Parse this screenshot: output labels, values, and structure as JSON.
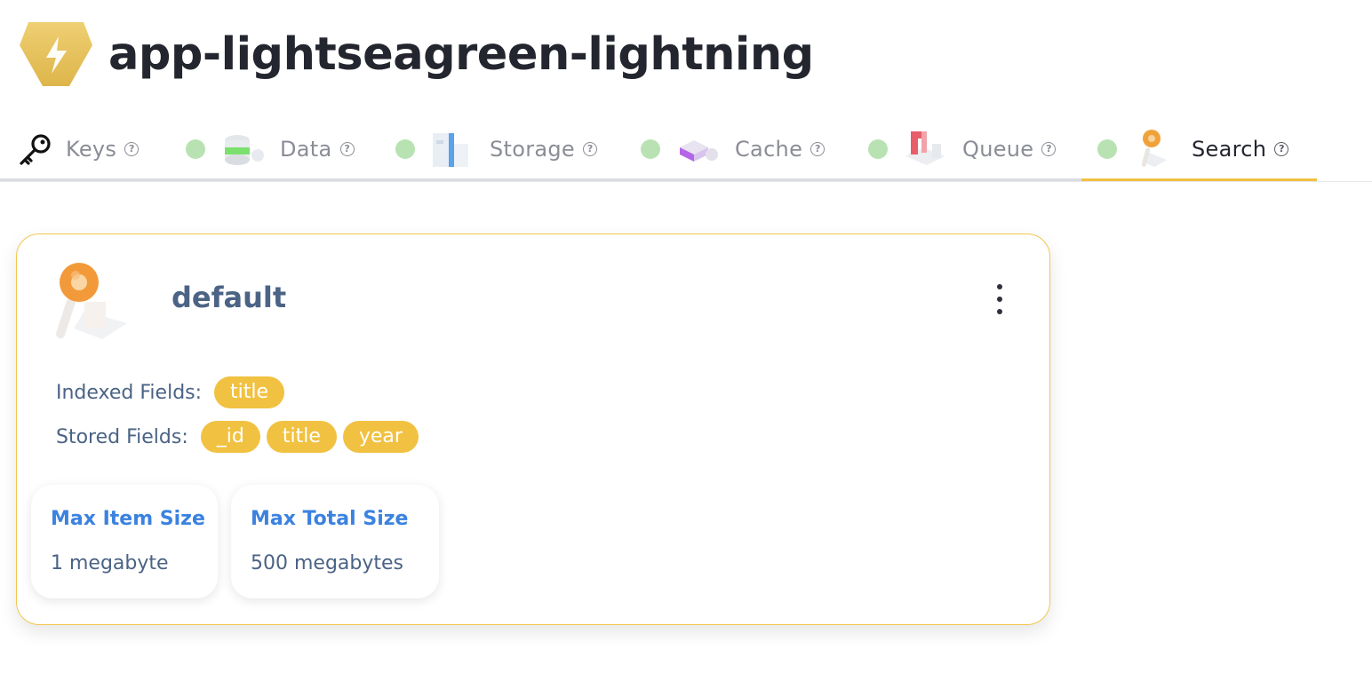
{
  "app": {
    "title": "app-lightseagreen-lightning",
    "logo_icon": "lightning-bolt-icon",
    "logo_color": "#e9c45a"
  },
  "tabs": [
    {
      "label": "Keys",
      "icon": "key-icon",
      "status": null,
      "active": false
    },
    {
      "label": "Data",
      "icon": "database-icon",
      "status": "online",
      "active": false
    },
    {
      "label": "Storage",
      "icon": "storage-icon",
      "status": "online",
      "active": false
    },
    {
      "label": "Cache",
      "icon": "cache-icon",
      "status": "online",
      "active": false
    },
    {
      "label": "Queue",
      "icon": "queue-icon",
      "status": "online",
      "active": false
    },
    {
      "label": "Search",
      "icon": "search-icon",
      "status": "online",
      "active": true
    }
  ],
  "help_glyph": "?",
  "index_card": {
    "name": "default",
    "icon": "search-magnifier-icon",
    "indexed_fields_label": "Indexed Fields:",
    "indexed_fields": [
      "title"
    ],
    "stored_fields_label": "Stored Fields:",
    "stored_fields": [
      "_id",
      "title",
      "year"
    ],
    "stats": [
      {
        "title": "Max Item Size",
        "value": "1 megabyte"
      },
      {
        "title": "Max Total Size",
        "value": "500 megabytes"
      }
    ]
  },
  "colors": {
    "accent": "#f1c141",
    "status_online": "#b9e2b3",
    "title_text": "#4b6385",
    "stat_title": "#3b82e0"
  }
}
